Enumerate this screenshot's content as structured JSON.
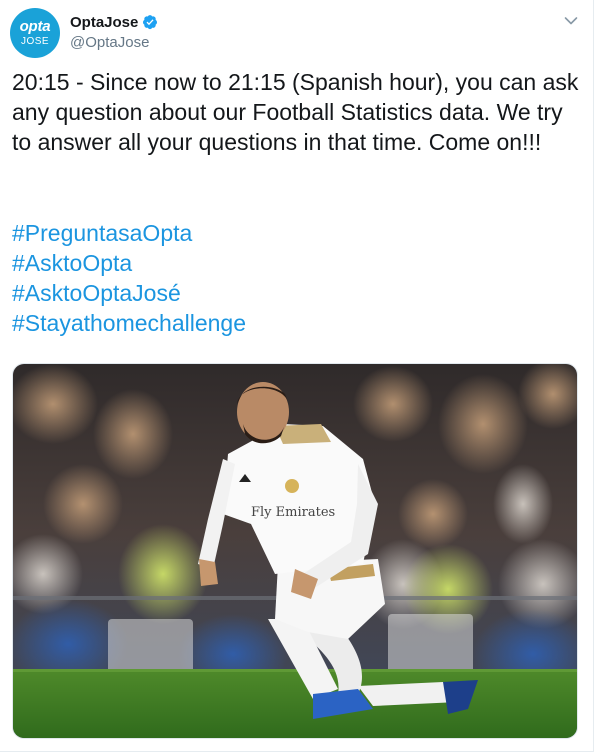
{
  "author": {
    "avatar_line1": "opta",
    "avatar_line2": "JOSE",
    "display_name": "OptaJose",
    "handle": "@OptaJose",
    "verified": true
  },
  "icons": {
    "verified": "verified-badge-icon",
    "menu": "chevron-down-icon"
  },
  "tweet": {
    "text": "20:15 - Since now to 21:15 (Spanish hour), you can ask any question about our Football Statistics data. We try to answer all your questions in that time. Come on!!!",
    "hashtags": [
      "#PreguntasaOpta",
      "#AsktoOpta",
      "#AsktoOptaJosé",
      "#Stayathomechallenge"
    ]
  },
  "media": {
    "shirt_sponsor": "Fly Emirates"
  },
  "colors": {
    "link": "#1b95e0",
    "brand": "#1aa2d8",
    "text": "#14171a",
    "secondary": "#657786"
  }
}
